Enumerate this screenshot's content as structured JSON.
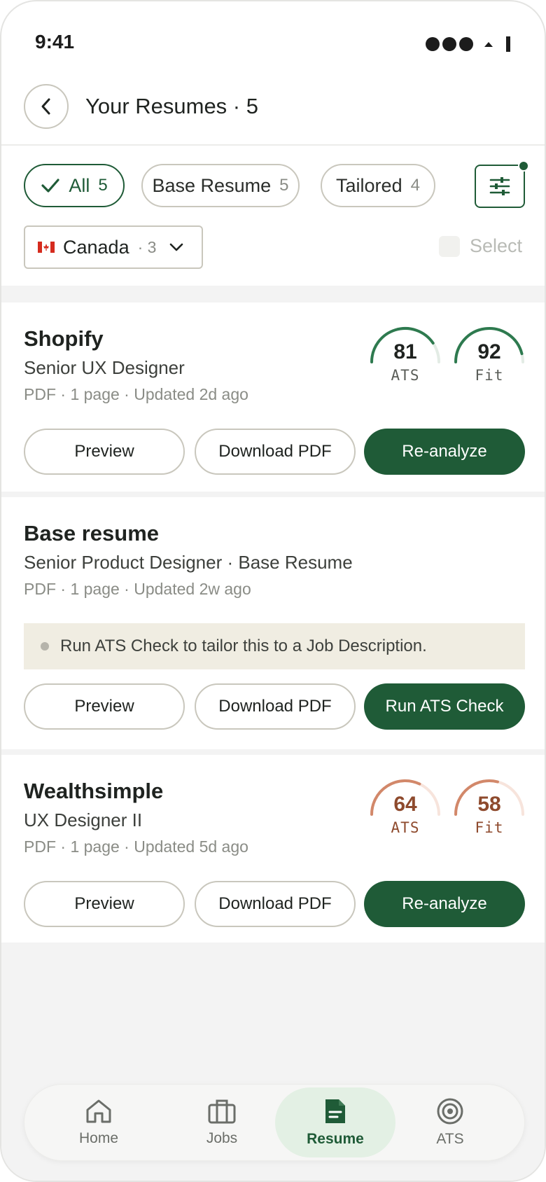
{
  "status_bar": {
    "time": "9:41"
  },
  "header": {
    "title": "Your Resumes · 5"
  },
  "filters": {
    "chips": [
      {
        "label": "All",
        "count": "5"
      },
      {
        "label": "Base Resume",
        "count": "5"
      },
      {
        "label": "Tailored",
        "count": "4"
      }
    ],
    "country": {
      "name": "Canada",
      "count": "· 3"
    },
    "select_label": "Select"
  },
  "cards": [
    {
      "company": "Shopify",
      "role": "Senior UX Designer",
      "meta": "PDF · 1 page · Updated 2d ago",
      "ats": {
        "value": "81",
        "label": "ATS",
        "fraction": 0.81
      },
      "fit": {
        "value": "92",
        "label": "Fit",
        "fraction": 0.92
      },
      "buttons": {
        "preview": "Preview",
        "download": "Download PDF",
        "primary": "Re-analyze"
      }
    },
    {
      "company": "Base resume",
      "role": "Senior Product Designer · Base Resume",
      "meta": "PDF · 1 page · Updated 2w ago",
      "notice": "Run ATS Check to tailor this to a Job Description.",
      "buttons": {
        "preview": "Preview",
        "download": "Download PDF",
        "primary": "Run ATS Check"
      }
    },
    {
      "company": "Wealthsimple",
      "role": "UX Designer II",
      "meta": "PDF · 1 page · Updated 5d ago",
      "ats": {
        "value": "64",
        "label": "ATS",
        "fraction": 0.64
      },
      "fit": {
        "value": "58",
        "label": "Fit",
        "fraction": 0.58
      },
      "buttons": {
        "preview": "Preview",
        "download": "Download PDF",
        "primary": "Re-analyze"
      }
    }
  ],
  "bottom_nav": {
    "items": [
      {
        "label": "Home",
        "icon": "home-icon"
      },
      {
        "label": "Jobs",
        "icon": "briefcase-icon"
      },
      {
        "label": "Resume",
        "icon": "document-icon"
      },
      {
        "label": "ATS",
        "icon": "target-icon"
      }
    ],
    "active": "Resume"
  },
  "colors": {
    "brand": "#1f5b37",
    "good_arc": "#2e7a4f",
    "good_track": "#e3ece5",
    "warn_arc": "#d2886a",
    "warn_track": "#f7e4dc"
  }
}
